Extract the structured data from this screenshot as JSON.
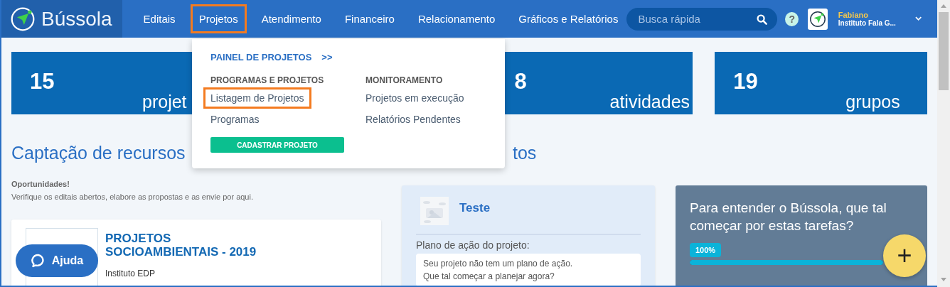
{
  "header": {
    "brand": "Bússola",
    "nav": [
      {
        "label": "Editais",
        "selected": false
      },
      {
        "label": "Projetos",
        "selected": true
      },
      {
        "label": "Atendimento",
        "selected": false
      },
      {
        "label": "Financeiro",
        "selected": false
      },
      {
        "label": "Relacionamento",
        "selected": false
      },
      {
        "label": "Gráficos e Relatórios",
        "selected": false
      }
    ],
    "search": {
      "placeholder": "Busca rápida"
    },
    "help": "?",
    "user": {
      "name": "Fabiano",
      "org": "Instituto Fala G..."
    }
  },
  "stats": [
    {
      "number": "15",
      "label": "projet"
    },
    {
      "number": "8",
      "label": "atividades"
    },
    {
      "number": "19",
      "label": "grupos"
    }
  ],
  "dropdown": {
    "panel_link": "PAINEL DE PROJETOS",
    "panel_arrow": ">>",
    "columns": [
      {
        "heading": "PROGRAMAS E PROJETOS",
        "links": [
          {
            "label": "Listagem de Projetos",
            "selected": true
          },
          {
            "label": "Programas",
            "selected": false
          }
        ]
      },
      {
        "heading": "MONITORAMENTO",
        "links": [
          {
            "label": "Projetos em execução",
            "selected": false
          },
          {
            "label": "Relatórios Pendentes",
            "selected": false
          }
        ]
      }
    ],
    "button": "CADASTRAR PROJETO"
  },
  "section_titles": [
    "Captação de recursos",
    "tos"
  ],
  "opportunities": {
    "title": "Oportunidades!",
    "text": "Verifique os editais abertos, elabore as propostas e as envie por aqui.",
    "card": {
      "title": "PROJETOS SOCIOAMBIENTAIS - 2019",
      "org": "Instituto EDP"
    }
  },
  "project": {
    "name": "Teste",
    "plan_label": "Plano de ação do projeto:",
    "plan_lines": [
      "Seu projeto não tem um plano de ação.",
      "Que tal começar a planejar agora?"
    ]
  },
  "tasks": {
    "title": "Para entender o Bússola, que tal começar por estas tarefas?",
    "progress_label": "100%",
    "level": 1
  },
  "help_button": "Ajuda",
  "fab": "+"
}
